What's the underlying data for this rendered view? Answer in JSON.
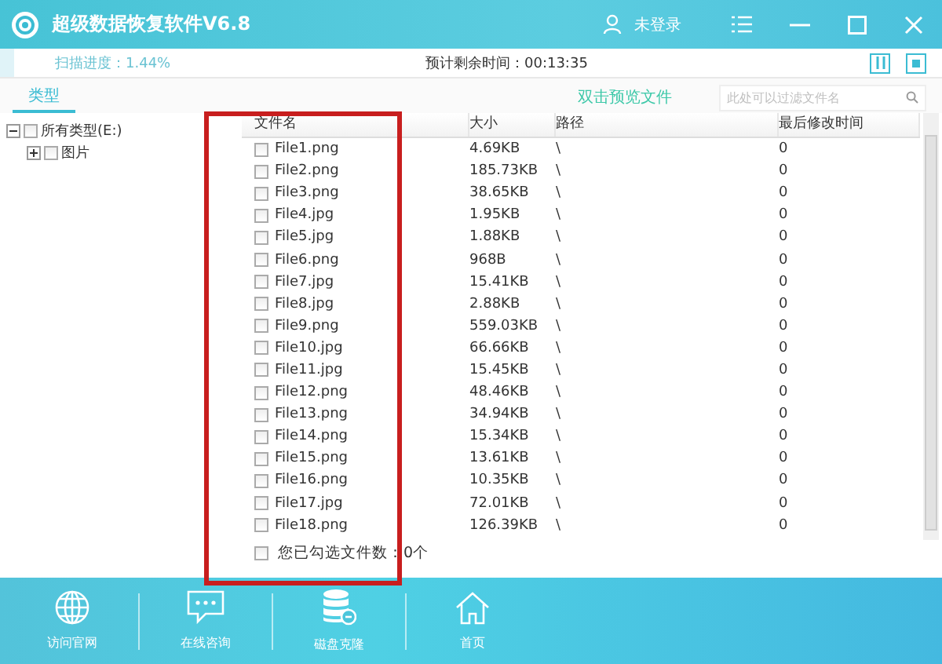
{
  "window": {
    "title": "超级数据恢复软件V6.8",
    "user": "未登录"
  },
  "scan": {
    "progress": "扫描进度：1.44%",
    "level": 0.0144,
    "remaining": "预计剩余时间：00:13:35"
  },
  "type_tab": {
    "label": "类型",
    "selected": true
  },
  "preview_hint": "双击预览文件",
  "search": {
    "placeholder": "此处可以过滤文件名"
  },
  "tree": [
    {
      "label": "所有类型(E:)",
      "checked": false,
      "expanded": true,
      "children": [
        {
          "label": "图片",
          "checked": false,
          "expanded": false
        }
      ]
    }
  ],
  "table": {
    "columns": [
      "文件名",
      "大小",
      "路径",
      "最后修改时间"
    ],
    "rows": [
      {
        "name": "File1.png",
        "size": "4.69KB",
        "path": "\\",
        "modified": "0",
        "checked": false
      },
      {
        "name": "File2.png",
        "size": "185.73KB",
        "path": "\\",
        "modified": "0",
        "checked": false
      },
      {
        "name": "File3.png",
        "size": "38.65KB",
        "path": "\\",
        "modified": "0",
        "checked": false
      },
      {
        "name": "File4.jpg",
        "size": "1.95KB",
        "path": "\\",
        "modified": "0",
        "checked": false
      },
      {
        "name": "File5.jpg",
        "size": "1.88KB",
        "path": "\\",
        "modified": "0",
        "checked": false
      },
      {
        "name": "File6.png",
        "size": "968B",
        "path": "\\",
        "modified": "0",
        "checked": false
      },
      {
        "name": "File7.jpg",
        "size": "15.41KB",
        "path": "\\",
        "modified": "0",
        "checked": false
      },
      {
        "name": "File8.jpg",
        "size": "2.88KB",
        "path": "\\",
        "modified": "0",
        "checked": false
      },
      {
        "name": "File9.png",
        "size": "559.03KB",
        "path": "\\",
        "modified": "0",
        "checked": false
      },
      {
        "name": "File10.jpg",
        "size": "66.66KB",
        "path": "\\",
        "modified": "0",
        "checked": false
      },
      {
        "name": "File11.jpg",
        "size": "15.45KB",
        "path": "\\",
        "modified": "0",
        "checked": false
      },
      {
        "name": "File12.png",
        "size": "48.46KB",
        "path": "\\",
        "modified": "0",
        "checked": false
      },
      {
        "name": "File13.png",
        "size": "34.94KB",
        "path": "\\",
        "modified": "0",
        "checked": false
      },
      {
        "name": "File14.png",
        "size": "15.34KB",
        "path": "\\",
        "modified": "0",
        "checked": false
      },
      {
        "name": "File15.png",
        "size": "13.61KB",
        "path": "\\",
        "modified": "0",
        "checked": false
      },
      {
        "name": "File16.png",
        "size": "10.35KB",
        "path": "\\",
        "modified": "0",
        "checked": false
      },
      {
        "name": "File17.jpg",
        "size": "72.01KB",
        "path": "\\",
        "modified": "0",
        "checked": false
      },
      {
        "name": "File18.png",
        "size": "126.39KB",
        "path": "\\",
        "modified": "0",
        "checked": false
      }
    ]
  },
  "selection": {
    "label": "您已勾选文件数：0个",
    "checked": false
  },
  "bottom_nav": [
    {
      "kind": "globe",
      "label": "访问官网"
    },
    {
      "kind": "chat",
      "label": "在线咨询"
    },
    {
      "kind": "disk",
      "label": "磁盘克隆"
    },
    {
      "kind": "home",
      "label": "首页"
    }
  ]
}
